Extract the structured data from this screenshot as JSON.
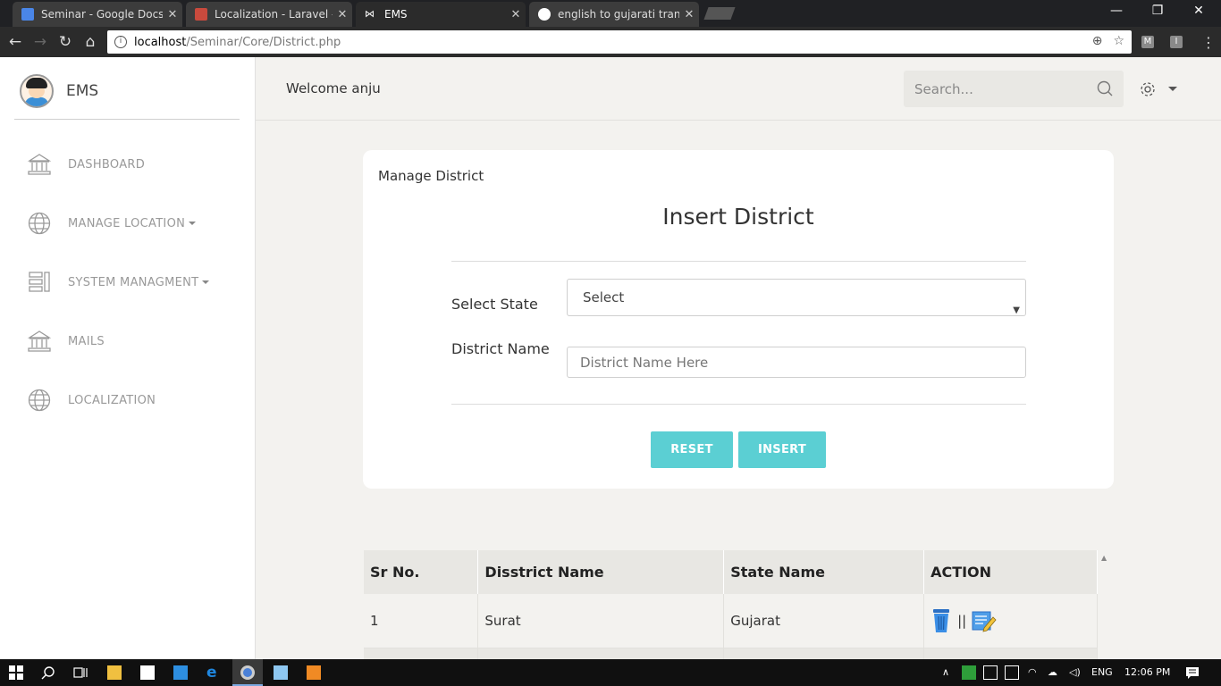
{
  "browser": {
    "tabs": [
      {
        "title": "Seminar - Google Docs",
        "active": false
      },
      {
        "title": "Localization - Laravel - Th",
        "active": false
      },
      {
        "title": "EMS",
        "active": true
      },
      {
        "title": "english to gujarati transla",
        "active": false
      }
    ],
    "url_host": "localhost",
    "url_path": "/Seminar/Core/District.php"
  },
  "sidebar": {
    "brand": "EMS",
    "items": [
      {
        "label": "DASHBOARD",
        "icon": "bank-icon",
        "dropdown": false
      },
      {
        "label": "MANAGE LOCATION",
        "icon": "globe-icon",
        "dropdown": true
      },
      {
        "label": "SYSTEM MANAGMENT",
        "icon": "layout-icon",
        "dropdown": true
      },
      {
        "label": "MAILS",
        "icon": "bank-icon",
        "dropdown": false
      },
      {
        "label": "LOCALIZATION",
        "icon": "globe-icon",
        "dropdown": false
      }
    ]
  },
  "header": {
    "welcome": "Welcome anju",
    "search_placeholder": "Search..."
  },
  "card": {
    "title": "Manage District",
    "form_title": "Insert District",
    "state_label": "Select State",
    "state_value": "Select",
    "district_label": "District Name",
    "district_placeholder": "District Name Here",
    "reset_label": "RESET",
    "insert_label": "INSERT"
  },
  "table": {
    "headers": [
      "Sr No.",
      "Disstrict Name",
      "State Name",
      "ACTION"
    ],
    "rows": [
      {
        "sr": "1",
        "district": "Surat",
        "state": "Gujarat",
        "sep": "||"
      }
    ]
  },
  "taskbar": {
    "language": "ENG",
    "time": "12:06 PM"
  },
  "colors": {
    "accent": "#5bcfd3",
    "page_bg": "#f3f2ef"
  }
}
